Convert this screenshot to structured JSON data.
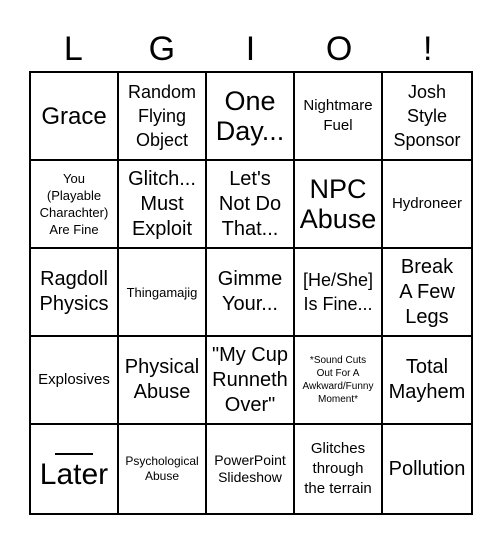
{
  "header": {
    "letters": [
      "L",
      "G",
      "I",
      "O",
      "!"
    ]
  },
  "board": {
    "rows": [
      [
        {
          "text": "Grace"
        },
        {
          "text": "Random\nFlying\nObject"
        },
        {
          "text": "One\nDay..."
        },
        {
          "text": "Nightmare\nFuel"
        },
        {
          "text": "Josh\nStyle\nSponsor"
        }
      ],
      [
        {
          "text": "You\n(Playable\nCharachter)\nAre Fine"
        },
        {
          "text": "Glitch...\nMust\nExploit"
        },
        {
          "text": "Let's\nNot Do\nThat..."
        },
        {
          "text": "NPC\nAbuse"
        },
        {
          "text": "Hydroneer"
        }
      ],
      [
        {
          "text": "Ragdoll\nPhysics"
        },
        {
          "text": "Thingamajig"
        },
        {
          "text": "Gimme\nYour..."
        },
        {
          "text": "[He/She]\nIs Fine..."
        },
        {
          "text": "Break\nA Few\nLegs"
        }
      ],
      [
        {
          "text": "Explosives"
        },
        {
          "text": "Physical\nAbuse"
        },
        {
          "text": "\"My Cup\nRunneth\nOver\""
        },
        {
          "text": "*Sound Cuts\nOut For A\nAwkward/Funny\nMoment*"
        },
        {
          "text": "Total\nMayhem"
        }
      ],
      [
        {
          "text": "Later",
          "blank_prefix": "____"
        },
        {
          "text": "Psychological\nAbuse"
        },
        {
          "text": "PowerPoint\nSlideshow"
        },
        {
          "text": "Glitches\nthrough\nthe terrain"
        },
        {
          "text": "Pollution"
        }
      ]
    ]
  }
}
